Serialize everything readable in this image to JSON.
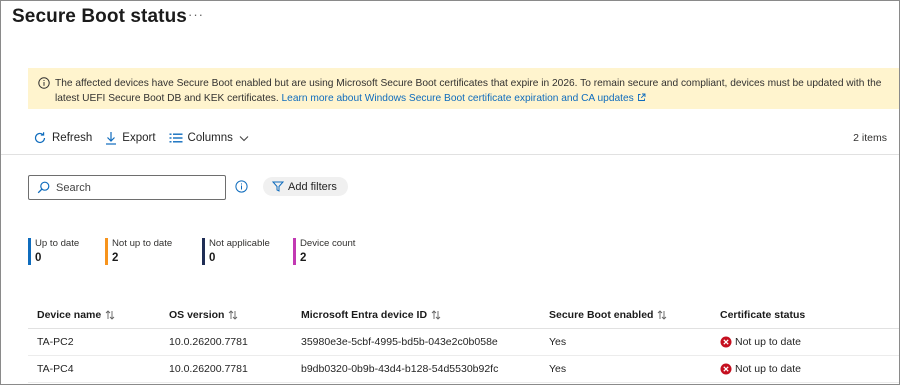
{
  "page": {
    "title": "Secure Boot status",
    "more_icon": "more-horizontal-icon"
  },
  "banner": {
    "icon": "info-circle-icon",
    "text": "The affected devices have Secure Boot enabled but are using Microsoft Secure Boot certificates that expire in 2026. To remain secure and compliant, devices must be updated with the latest UEFI Secure Boot DB and KEK certificates.",
    "link_text": "Learn more about Windows Secure Boot certificate expiration and CA updates",
    "link_icon": "external-link-icon",
    "background": "#fff4ce"
  },
  "toolbar": {
    "refresh_label": "Refresh",
    "export_label": "Export",
    "columns_label": "Columns",
    "items_count": "2 items"
  },
  "search": {
    "placeholder": "Search",
    "value": ""
  },
  "filters": {
    "add_label": "Add filters"
  },
  "summary": {
    "tiles": [
      {
        "label": "Up to date",
        "value": "0",
        "color": "#0f6cbd"
      },
      {
        "label": "Not up to date",
        "value": "2",
        "color": "#f7941d"
      },
      {
        "label": "Not applicable",
        "value": "0",
        "color": "#1f2d55"
      },
      {
        "label": "Device count",
        "value": "2",
        "color": "#c239b3"
      }
    ]
  },
  "table": {
    "columns": [
      {
        "label": "Device name",
        "sortable": true
      },
      {
        "label": "OS version",
        "sortable": true
      },
      {
        "label": "Microsoft Entra device ID",
        "sortable": true
      },
      {
        "label": "Secure Boot enabled",
        "sortable": true
      },
      {
        "label": "Certificate status",
        "sortable": false
      }
    ],
    "rows": [
      {
        "device_name": "TA-PC2",
        "os_version": "10.0.26200.7781",
        "entra_id": "35980e3e-5cbf-4995-bd5b-043e2c0b058e",
        "secure_boot": "Yes",
        "cert_status": "Not up to date"
      },
      {
        "device_name": "TA-PC4",
        "os_version": "10.0.26200.7781",
        "entra_id": "b9db0320-0b9b-43d4-b128-54d5530b92fc",
        "secure_boot": "Yes",
        "cert_status": "Not up to date"
      }
    ],
    "status_color": "#c50f1f"
  }
}
